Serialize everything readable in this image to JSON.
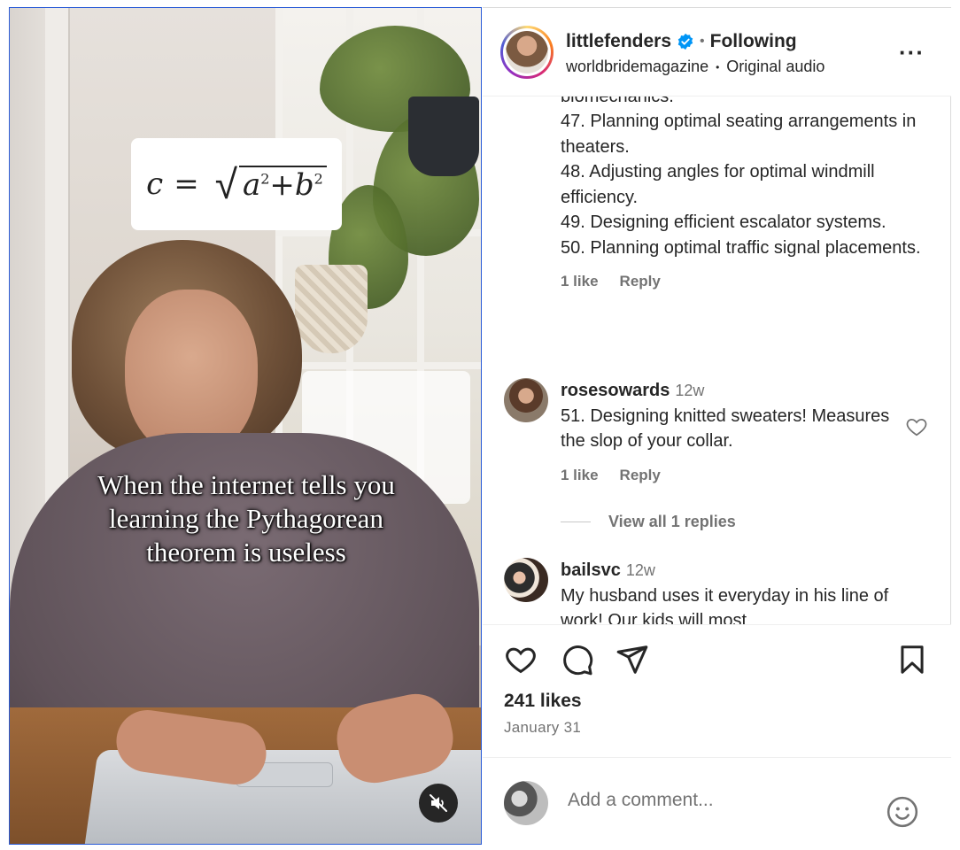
{
  "video": {
    "formula": {
      "lhs": "c",
      "eq": "=",
      "a": "a",
      "b": "b",
      "exp": "2",
      "plus": "+"
    },
    "caption": [
      "When the internet tells you",
      "learning the Pythagorean",
      "theorem is useless"
    ],
    "mute_icon": "speaker-muted-icon"
  },
  "header": {
    "username": "littlefenders",
    "verified_icon": "verified-badge-icon",
    "dot": "•",
    "following": "Following",
    "collab": "worldbridemagazine",
    "audio": "Original audio",
    "more": "···"
  },
  "comments": {
    "cut_text": "biomechanics.",
    "list": [
      "47. Planning optimal seating arrangements in theaters.",
      "48. Adjusting angles for optimal windmill efficiency.",
      "49. Designing efficient escalator systems.",
      "50. Planning optimal traffic signal placements."
    ],
    "first_meta": {
      "likes": "1 like",
      "reply": "Reply"
    },
    "items": [
      {
        "user": "rosesowards",
        "time": "12w",
        "text": "51. Designing knitted sweaters! Measures the slop of your collar.",
        "likes": "1 like",
        "reply": "Reply",
        "view_replies": "View all 1 replies"
      },
      {
        "user": "bailsvc",
        "time": "12w",
        "text": "My husband uses it everyday in his line of work! Our kids will most"
      }
    ]
  },
  "actions": {
    "likes": "241 likes",
    "date": "January 31"
  },
  "add_comment": {
    "placeholder": "Add a comment..."
  }
}
